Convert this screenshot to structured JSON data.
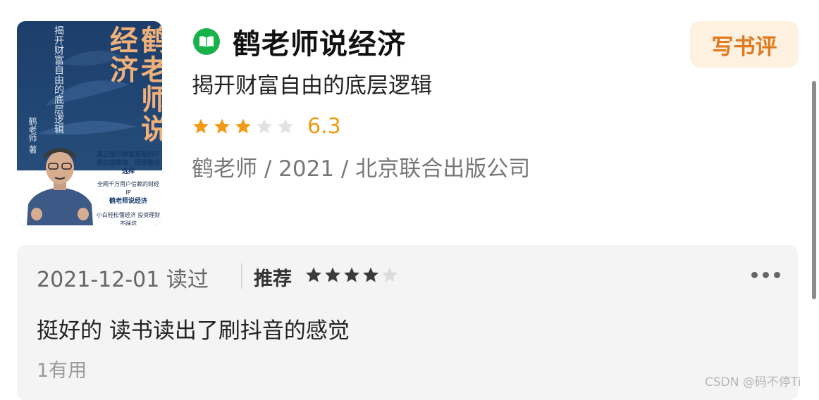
{
  "book": {
    "title": "鹤老师说经济",
    "subtitle": "揭开财富自由的底层逻辑",
    "rating": {
      "score": "6.3",
      "stars_filled": 3,
      "stars_total": 5
    },
    "meta": "鹤老师 / 2021 / 北京联合出版公司",
    "cover": {
      "title": "鹤老师说经济",
      "subtitle": "揭开财富自由的底层逻辑",
      "author": "鹤老师 著",
      "blurb_1": "真正拉开财富差距的不是加班熬夜，而是做对选择",
      "blurb_2": "全网千万用户信赖的财经IP",
      "blurb_3": "鹤老师说经济",
      "blurb_4": "小白轻松懂经济 投资理财不踩坑"
    }
  },
  "actions": {
    "write_review": "写书评"
  },
  "review": {
    "date_read": "2021-12-01 读过",
    "recommend_label": "推荐",
    "recommend_stars": 4,
    "text": "挺好的 读书读出了刷抖音的感觉",
    "helpful": "1有用"
  },
  "watermark": "CSDN @码不停Ti",
  "colors": {
    "accent": "#f29a13",
    "badge": "#18b24b",
    "button_bg": "#fff1e0",
    "button_text": "#e07a1f"
  },
  "icons": {
    "book": "open-book-icon",
    "star": "star-icon",
    "more": "more-dots-icon"
  }
}
